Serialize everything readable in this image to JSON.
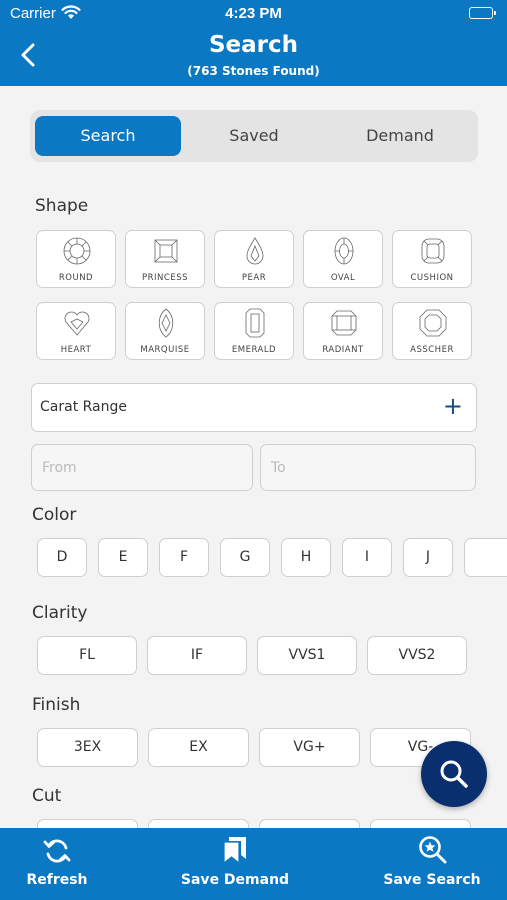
{
  "status_bar": {
    "carrier": "Carrier",
    "time": "4:23 PM"
  },
  "header": {
    "title": "Search",
    "subtitle": "(763 Stones Found)"
  },
  "segments": [
    "Search",
    "Saved",
    "Demand"
  ],
  "active_segment": "Search",
  "shape": {
    "title": "Shape",
    "items": [
      "ROUND",
      "PRINCESS",
      "PEAR",
      "OVAL",
      "CUSHION",
      "HEART",
      "MARQUISE",
      "EMERALD",
      "RADIANT",
      "ASSCHER"
    ]
  },
  "carat": {
    "label": "Carat Range",
    "from_placeholder": "From",
    "to_placeholder": "To"
  },
  "color": {
    "title": "Color",
    "items": [
      "D",
      "E",
      "F",
      "G",
      "H",
      "I",
      "J"
    ]
  },
  "clarity": {
    "title": "Clarity",
    "items": [
      "FL",
      "IF",
      "VVS1",
      "VVS2"
    ]
  },
  "finish": {
    "title": "Finish",
    "items": [
      "3EX",
      "EX",
      "VG+",
      "VG-"
    ]
  },
  "cut": {
    "title": "Cut"
  },
  "tabbar": {
    "items": [
      "Refresh",
      "Save Demand",
      "Save Search"
    ]
  },
  "colors": {
    "brand_blue": "#0a78c2",
    "fab_navy": "#0a2f6e"
  }
}
